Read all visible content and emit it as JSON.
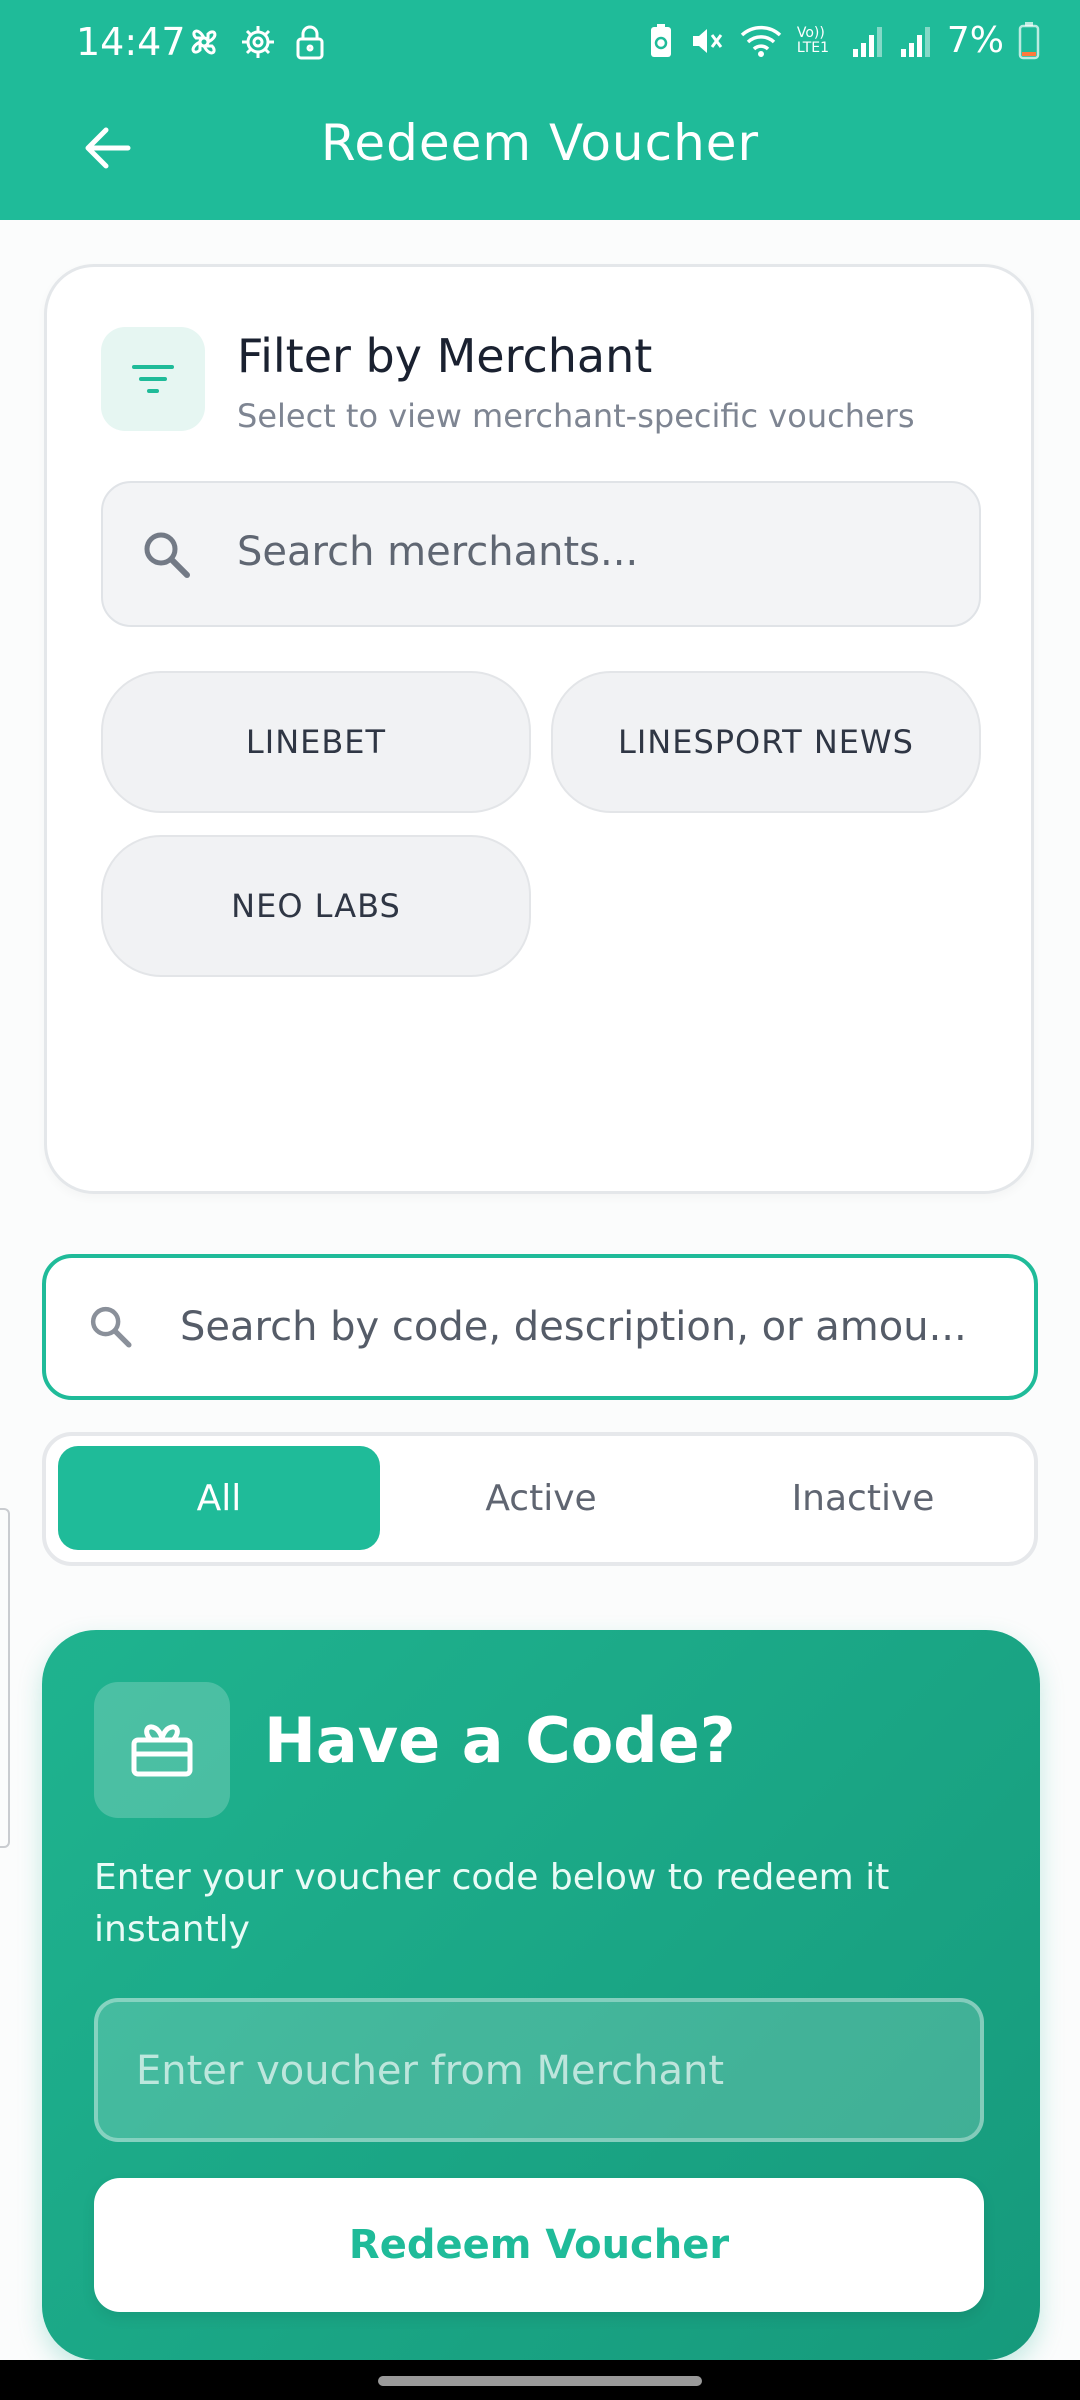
{
  "status_bar": {
    "time": "14:47",
    "battery_percent": "7%",
    "network_label": "Vo)) LTE1"
  },
  "toolbar": {
    "title": "Redeem Voucher",
    "back_icon": "arrow-left-icon"
  },
  "filter": {
    "title": "Filter by Merchant",
    "subtitle": "Select to view merchant-specific vouchers",
    "search_placeholder": "Search merchants...",
    "merchants": [
      "LINEBET",
      "LINESPORT NEWS",
      "NEO LABS"
    ]
  },
  "voucher_search": {
    "placeholder": "Search by code, description, or amou..."
  },
  "tabs": {
    "items": [
      "All",
      "Active",
      "Inactive"
    ],
    "selected": "All"
  },
  "code_card": {
    "title": "Have a Code?",
    "description": "Enter your voucher code below to redeem it instantly",
    "input_placeholder": "Enter voucher from Merchant",
    "button_label": "Redeem Voucher"
  },
  "colors": {
    "accent": "#1fbb99",
    "accent_dark": "#169a7c"
  }
}
